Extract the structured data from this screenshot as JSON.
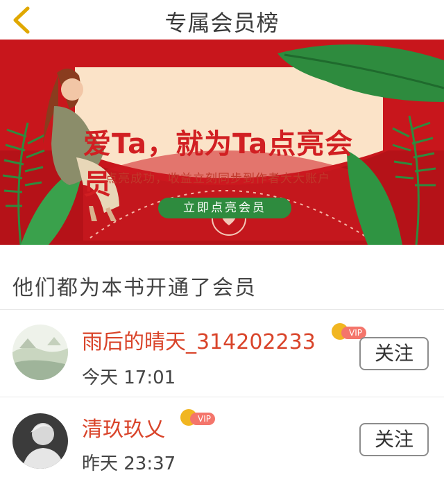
{
  "header": {
    "title": "专属会员榜",
    "back_icon": "chevron-left-icon"
  },
  "banner": {
    "headline": "爱Ta，就为Ta点亮会员",
    "subtitle": "点亮成功，收益立刻同步到作者大大账户",
    "cta_label": "立即点亮会员",
    "colors": {
      "background": "#c8161c",
      "card": "#fbe3c8",
      "button": "#2e8b3e"
    }
  },
  "section": {
    "title": "他们都为本书开通了会员"
  },
  "members": [
    {
      "name": "雨后的晴天_314202233",
      "time": "今天 17:01",
      "vip_label": "VIP",
      "follow_label": "关注",
      "avatar": "landscape-avatar"
    },
    {
      "name": "清玖玖乂",
      "time": "昨天 23:37",
      "vip_label": "VIP",
      "follow_label": "关注",
      "avatar": "person-avatar"
    }
  ],
  "colors": {
    "name": "#d9442a",
    "vip_badge": "#f4756b",
    "crown": "#f1b621"
  }
}
